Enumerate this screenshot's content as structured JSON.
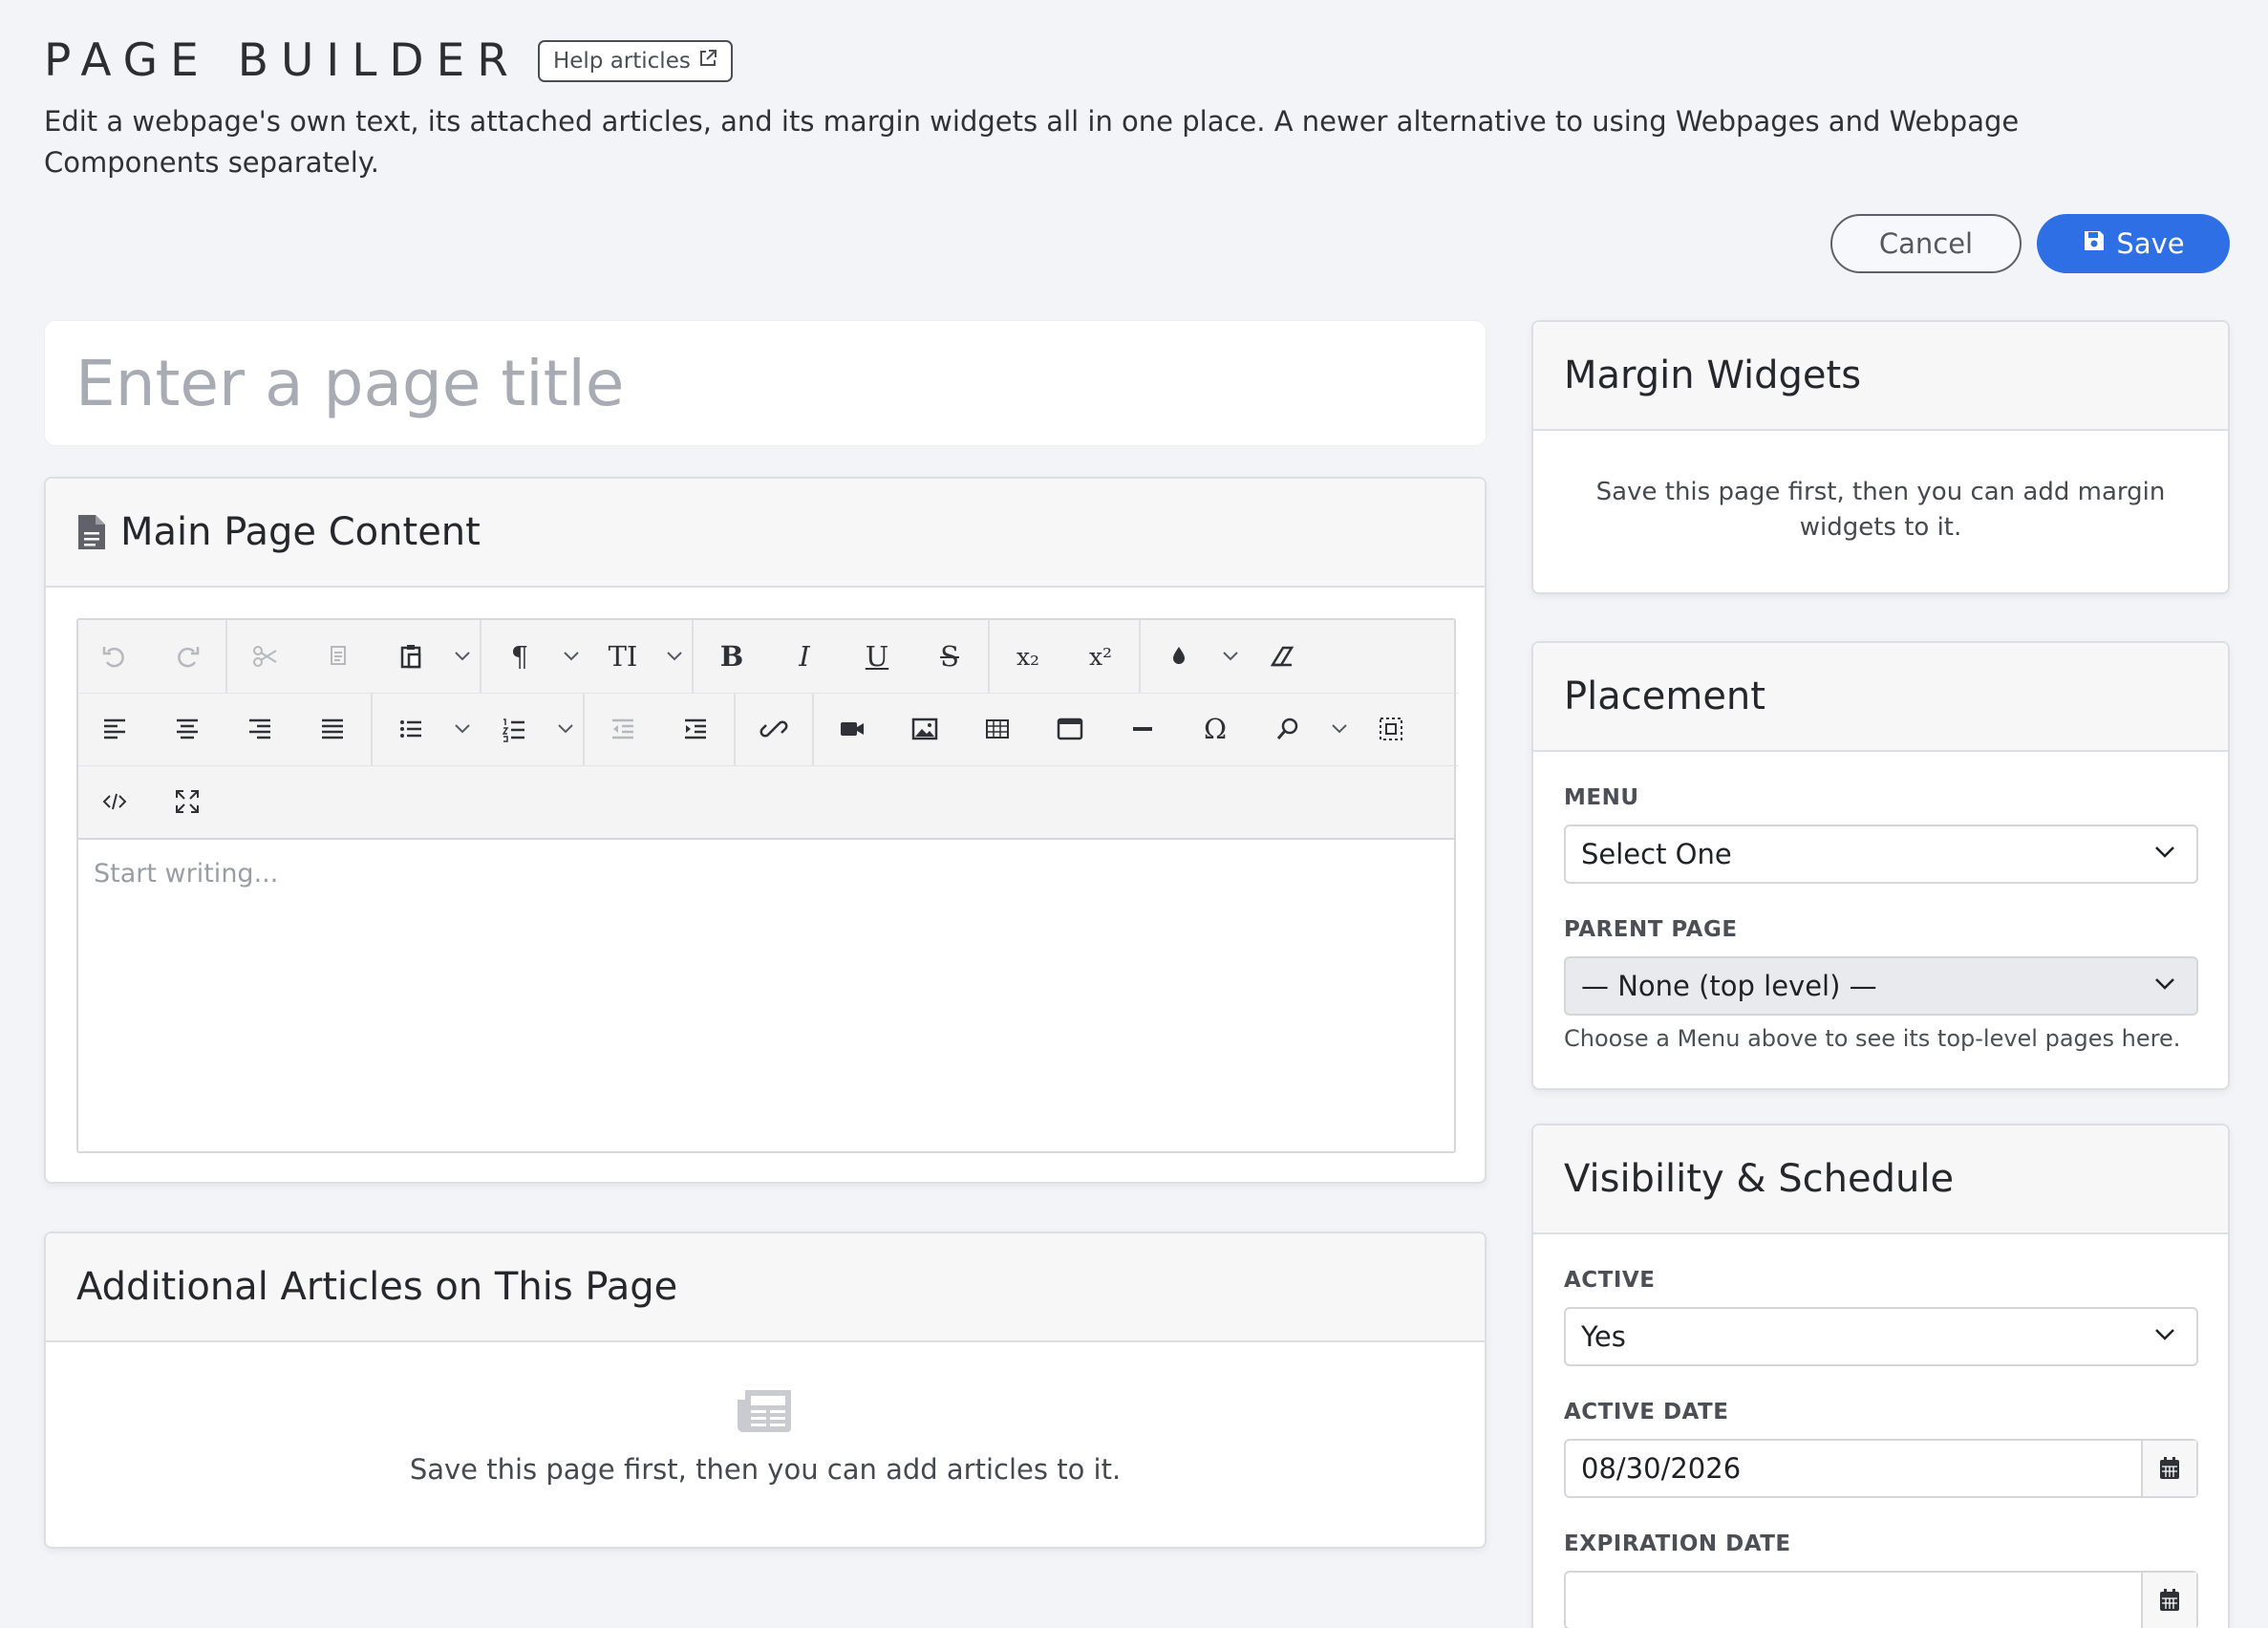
{
  "header": {
    "title": "PAGE BUILDER",
    "help_label": "Help articles",
    "description": "Edit a webpage's own text, its attached articles, and its margin widgets all in one place. A newer alternative to using Webpages and Webpage Components separately."
  },
  "actions": {
    "cancel_label": "Cancel",
    "save_label": "Save"
  },
  "title_input": {
    "placeholder": "Enter a page title"
  },
  "main_content": {
    "title": "Main Page Content",
    "editor_placeholder": "Start writing..."
  },
  "articles": {
    "title": "Additional Articles on This Page",
    "message": "Save this page first, then you can add articles to it."
  },
  "margin_widgets": {
    "title": "Margin Widgets",
    "message": "Save this page first, then you can add margin widgets to it."
  },
  "placement": {
    "title": "Placement",
    "menu_label": "MENU",
    "menu_value": "Select One",
    "parent_label": "PARENT PAGE",
    "parent_value": "— None (top level) —",
    "parent_help": "Choose a Menu above to see its top-level pages here."
  },
  "visibility": {
    "title": "Visibility & Schedule",
    "active_label": "ACTIVE",
    "active_value": "Yes",
    "active_date_label": "ACTIVE DATE",
    "active_date_value": "08/30/2026",
    "expiration_label": "EXPIRATION DATE",
    "expiration_value": ""
  },
  "toolbar": {
    "paragraph": "¶",
    "text_size": "TI",
    "bold": "B",
    "italic": "I",
    "underline": "U",
    "strike": "S",
    "subscript": "x₂",
    "superscript": "x²",
    "special_char": "Ω"
  },
  "colors": {
    "accent": "#2f6fe6",
    "background": "#f3f4f8"
  }
}
